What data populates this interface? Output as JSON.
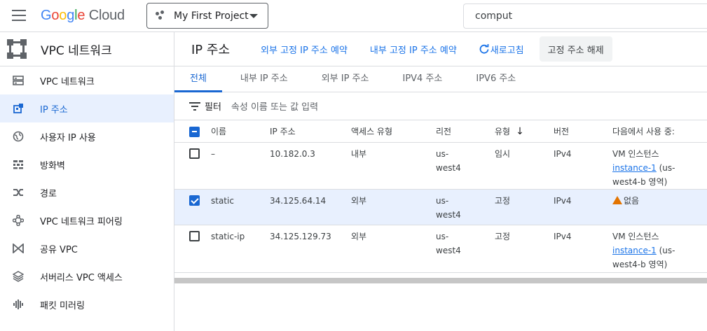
{
  "topbar": {
    "logo_google": [
      "G",
      "o",
      "o",
      "g",
      "l",
      "e"
    ],
    "logo_cloud": "Cloud",
    "project": "My First Project",
    "search_value": "comput"
  },
  "sidebar": {
    "title": "VPC 네트워크",
    "items": [
      {
        "label": "VPC 네트워크",
        "icon": "vpc-network-icon",
        "active": false
      },
      {
        "label": "IP 주소",
        "icon": "ip-address-icon",
        "active": true
      },
      {
        "label": "사용자 IP 사용",
        "icon": "globe-icon",
        "active": false
      },
      {
        "label": "방화벽",
        "icon": "firewall-icon",
        "active": false
      },
      {
        "label": "경로",
        "icon": "routes-icon",
        "active": false
      },
      {
        "label": "VPC 네트워크 피어링",
        "icon": "peering-icon",
        "active": false
      },
      {
        "label": "공유 VPC",
        "icon": "shared-vpc-icon",
        "active": false
      },
      {
        "label": "서버리스 VPC 액세스",
        "icon": "serverless-icon",
        "active": false
      },
      {
        "label": "패킷 미러링",
        "icon": "packet-mirroring-icon",
        "active": false
      }
    ]
  },
  "header": {
    "title": "IP 주소",
    "reserve_external": "외부 고정 IP 주소 예약",
    "reserve_internal": "내부 고정 IP 주소 예약",
    "refresh": "새로고침",
    "release": "고정 주소 해제"
  },
  "tabs": [
    "전체",
    "내부 IP 주소",
    "외부 IP 주소",
    "IPV4 주소",
    "IPV6 주소"
  ],
  "filter": {
    "label": "필터",
    "placeholder": "속성 이름 또는 값 입력"
  },
  "table": {
    "columns": [
      "이름",
      "IP 주소",
      "액세스 유형",
      "리전",
      "유형",
      "버전",
      "다음에서 사용 중:"
    ],
    "rows": [
      {
        "name": "–",
        "ip": "10.182.0.3",
        "access": "내부",
        "region_a": "us-",
        "region_b": "west4",
        "type": "임시",
        "version": "IPv4",
        "usedby_a": "VM 인스턴스",
        "usedby_link": "instance-1",
        "usedby_b": " (us-",
        "usedby_c": "west4-b 영역)",
        "checked": false
      },
      {
        "name": "static",
        "ip": "34.125.64.14",
        "access": "외부",
        "region_a": "us-",
        "region_b": "west4",
        "type": "고정",
        "version": "IPv4",
        "usedby_none": "없음",
        "checked": true
      },
      {
        "name": "static-ip",
        "ip": "34.125.129.73",
        "access": "외부",
        "region_a": "us-",
        "region_b": "west4",
        "type": "고정",
        "version": "IPv4",
        "usedby_a": "VM 인스턴스",
        "usedby_link": "instance-1",
        "usedby_b": " (us-",
        "usedby_c": "west4-b 영역)",
        "checked": false
      }
    ]
  },
  "colors": {
    "accent": "#1967d2",
    "warning": "#e37400",
    "selected_row": "#e8f0fe"
  }
}
